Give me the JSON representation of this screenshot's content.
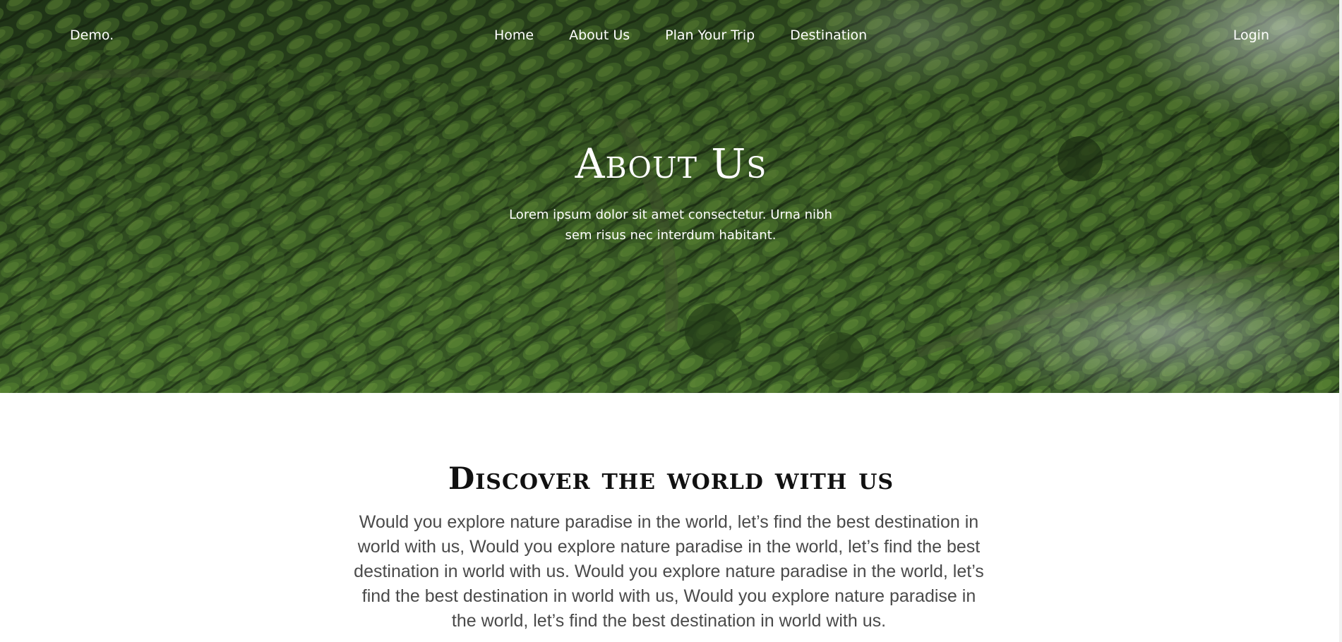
{
  "nav": {
    "brand": "Demo.",
    "links": [
      {
        "label": "Home"
      },
      {
        "label": "About Us"
      },
      {
        "label": "Plan Your Trip"
      },
      {
        "label": "Destination"
      }
    ],
    "login": "Login"
  },
  "hero": {
    "title": "About Us",
    "subtitle": "Lorem ipsum dolor sit amet consectetur. Urna nibh sem risus nec interdum habitant."
  },
  "section": {
    "title": "Discover the world with us",
    "text": "Would you explore nature paradise in the world, let’s find the best destination in world with us, Would you explore nature paradise in the world, let’s find the best destination in world with us. Would you explore nature paradise in the world, let’s find the best destination in world with us, Would you explore nature paradise in the world, let’s find the best destination in world with us."
  },
  "colors": {
    "hero_green": "#2e4a22",
    "text_white": "#ffffff",
    "heading": "#111111",
    "body_text": "#4a4a4a"
  }
}
